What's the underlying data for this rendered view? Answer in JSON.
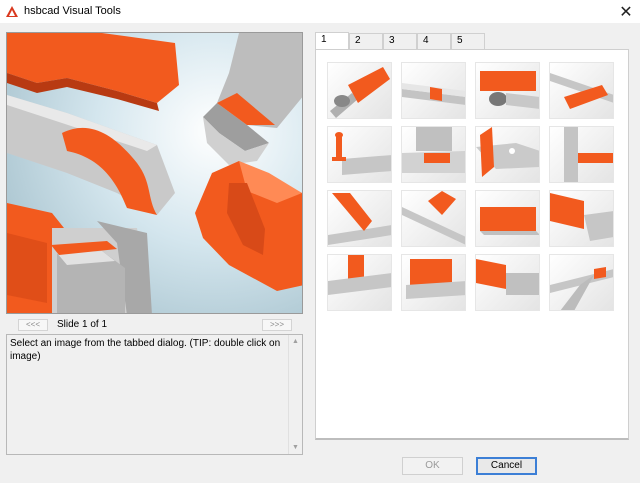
{
  "window": {
    "title": "hsbcad Visual Tools",
    "close_glyph": "✕",
    "app_icon": "hsbcad-logo-icon"
  },
  "preview": {
    "slide_label": "Slide 1 of 1",
    "prev_label": "<<<",
    "next_label": ">>>",
    "description": "Select an image from the tabbed dialog. (TIP: double click on image)"
  },
  "tabs": [
    {
      "label": "1",
      "active": true
    },
    {
      "label": "2",
      "active": false
    },
    {
      "label": "3",
      "active": false
    },
    {
      "label": "4",
      "active": false
    },
    {
      "label": "5",
      "active": false
    }
  ],
  "thumbnails": [
    {
      "name": "thumb-1"
    },
    {
      "name": "thumb-2"
    },
    {
      "name": "thumb-3"
    },
    {
      "name": "thumb-4"
    },
    {
      "name": "thumb-5"
    },
    {
      "name": "thumb-6"
    },
    {
      "name": "thumb-7"
    },
    {
      "name": "thumb-8"
    },
    {
      "name": "thumb-9"
    },
    {
      "name": "thumb-10"
    },
    {
      "name": "thumb-11"
    },
    {
      "name": "thumb-12"
    },
    {
      "name": "thumb-13"
    },
    {
      "name": "thumb-14"
    },
    {
      "name": "thumb-15"
    },
    {
      "name": "thumb-16"
    }
  ],
  "buttons": {
    "ok_label": "OK",
    "ok_enabled": false,
    "cancel_label": "Cancel"
  },
  "colors": {
    "accent_orange": "#f25a1e",
    "focus_blue": "#3c7fd6"
  }
}
